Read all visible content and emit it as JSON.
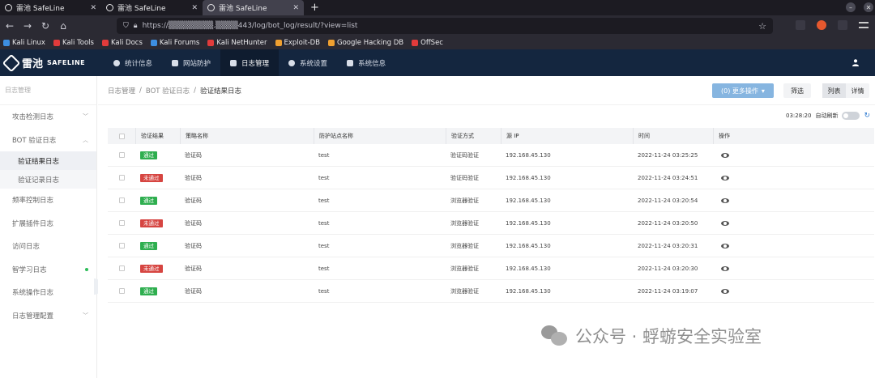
{
  "browser": {
    "tabs": [
      {
        "label": "雷池 SafeLine",
        "active": false
      },
      {
        "label": "雷池 SafeLine",
        "active": false
      },
      {
        "label": "雷池 SafeLine",
        "active": true
      }
    ],
    "url": "https://▒▒▒▒▒▒▒▒.▒▒▒▒443/log/bot_log/result/?view=list",
    "bookmarks": [
      {
        "label": "Kali Linux",
        "color": "#3d8ee0"
      },
      {
        "label": "Kali Tools",
        "color": "#e23b3b"
      },
      {
        "label": "Kali Docs",
        "color": "#e23b3b"
      },
      {
        "label": "Kali Forums",
        "color": "#3d8ee0"
      },
      {
        "label": "Kali NetHunter",
        "color": "#e23b3b"
      },
      {
        "label": "Exploit-DB",
        "color": "#f0a030"
      },
      {
        "label": "Google Hacking DB",
        "color": "#f0a030"
      },
      {
        "label": "OffSec",
        "color": "#e23b3b"
      }
    ]
  },
  "app": {
    "logo_cn": "雷池",
    "logo_en": "SAFELINE",
    "nav": [
      {
        "label": "统计信息",
        "active": false
      },
      {
        "label": "网站防护",
        "active": false
      },
      {
        "label": "日志管理",
        "active": true
      },
      {
        "label": "系统设置",
        "active": false
      },
      {
        "label": "系统信息",
        "active": false
      }
    ]
  },
  "sidebar": {
    "title": "日志管理",
    "items": [
      {
        "label": "攻击检测日志"
      },
      {
        "label": "BOT 验证日志"
      },
      {
        "label": "验证结果日志"
      },
      {
        "label": "验证记录日志"
      },
      {
        "label": "频率控制日志"
      },
      {
        "label": "扩展插件日志"
      },
      {
        "label": "访问日志"
      },
      {
        "label": "智学习日志"
      },
      {
        "label": "系统操作日志"
      },
      {
        "label": "日志管理配置"
      }
    ]
  },
  "breadcrumb": {
    "items": [
      "日志管理",
      "BOT 验证日志",
      "验证结果日志"
    ],
    "sep": "/"
  },
  "toolbar": {
    "more_label": "(0) 更多操作",
    "filter_label": "筛选",
    "view_list": "列表",
    "view_detail": "详情",
    "time": "03:28:20",
    "auto_refresh": "自动刷新"
  },
  "table": {
    "headers": [
      "验证结果",
      "策略名称",
      "防护站点名称",
      "验证方式",
      "源 IP",
      "时间",
      "操作"
    ],
    "rows": [
      {
        "result": "通过",
        "status": "pass",
        "policy": "验证码",
        "site": "test",
        "method": "验证码验证",
        "ip": "192.168.45.130",
        "time": "2022-11-24 03:25:25"
      },
      {
        "result": "未通过",
        "status": "fail",
        "policy": "验证码",
        "site": "test",
        "method": "验证码验证",
        "ip": "192.168.45.130",
        "time": "2022-11-24 03:24:51"
      },
      {
        "result": "通过",
        "status": "pass",
        "policy": "验证码",
        "site": "test",
        "method": "浏览器验证",
        "ip": "192.168.45.130",
        "time": "2022-11-24 03:20:54"
      },
      {
        "result": "未通过",
        "status": "fail",
        "policy": "验证码",
        "site": "test",
        "method": "浏览器验证",
        "ip": "192.168.45.130",
        "time": "2022-11-24 03:20:50"
      },
      {
        "result": "通过",
        "status": "pass",
        "policy": "验证码",
        "site": "test",
        "method": "浏览器验证",
        "ip": "192.168.45.130",
        "time": "2022-11-24 03:20:31"
      },
      {
        "result": "未通过",
        "status": "fail",
        "policy": "验证码",
        "site": "test",
        "method": "浏览器验证",
        "ip": "192.168.45.130",
        "time": "2022-11-24 03:20:30"
      },
      {
        "result": "通过",
        "status": "pass",
        "policy": "验证码",
        "site": "test",
        "method": "浏览器验证",
        "ip": "192.168.45.130",
        "time": "2022-11-24 03:19:07"
      }
    ]
  },
  "watermark": {
    "text": "公众号 · 蜉蝣安全实验室"
  },
  "colors": {
    "pass": "#2eae4f",
    "fail": "#d64541",
    "header_bg": "#14263f",
    "primary_btn": "#86b5e0"
  }
}
